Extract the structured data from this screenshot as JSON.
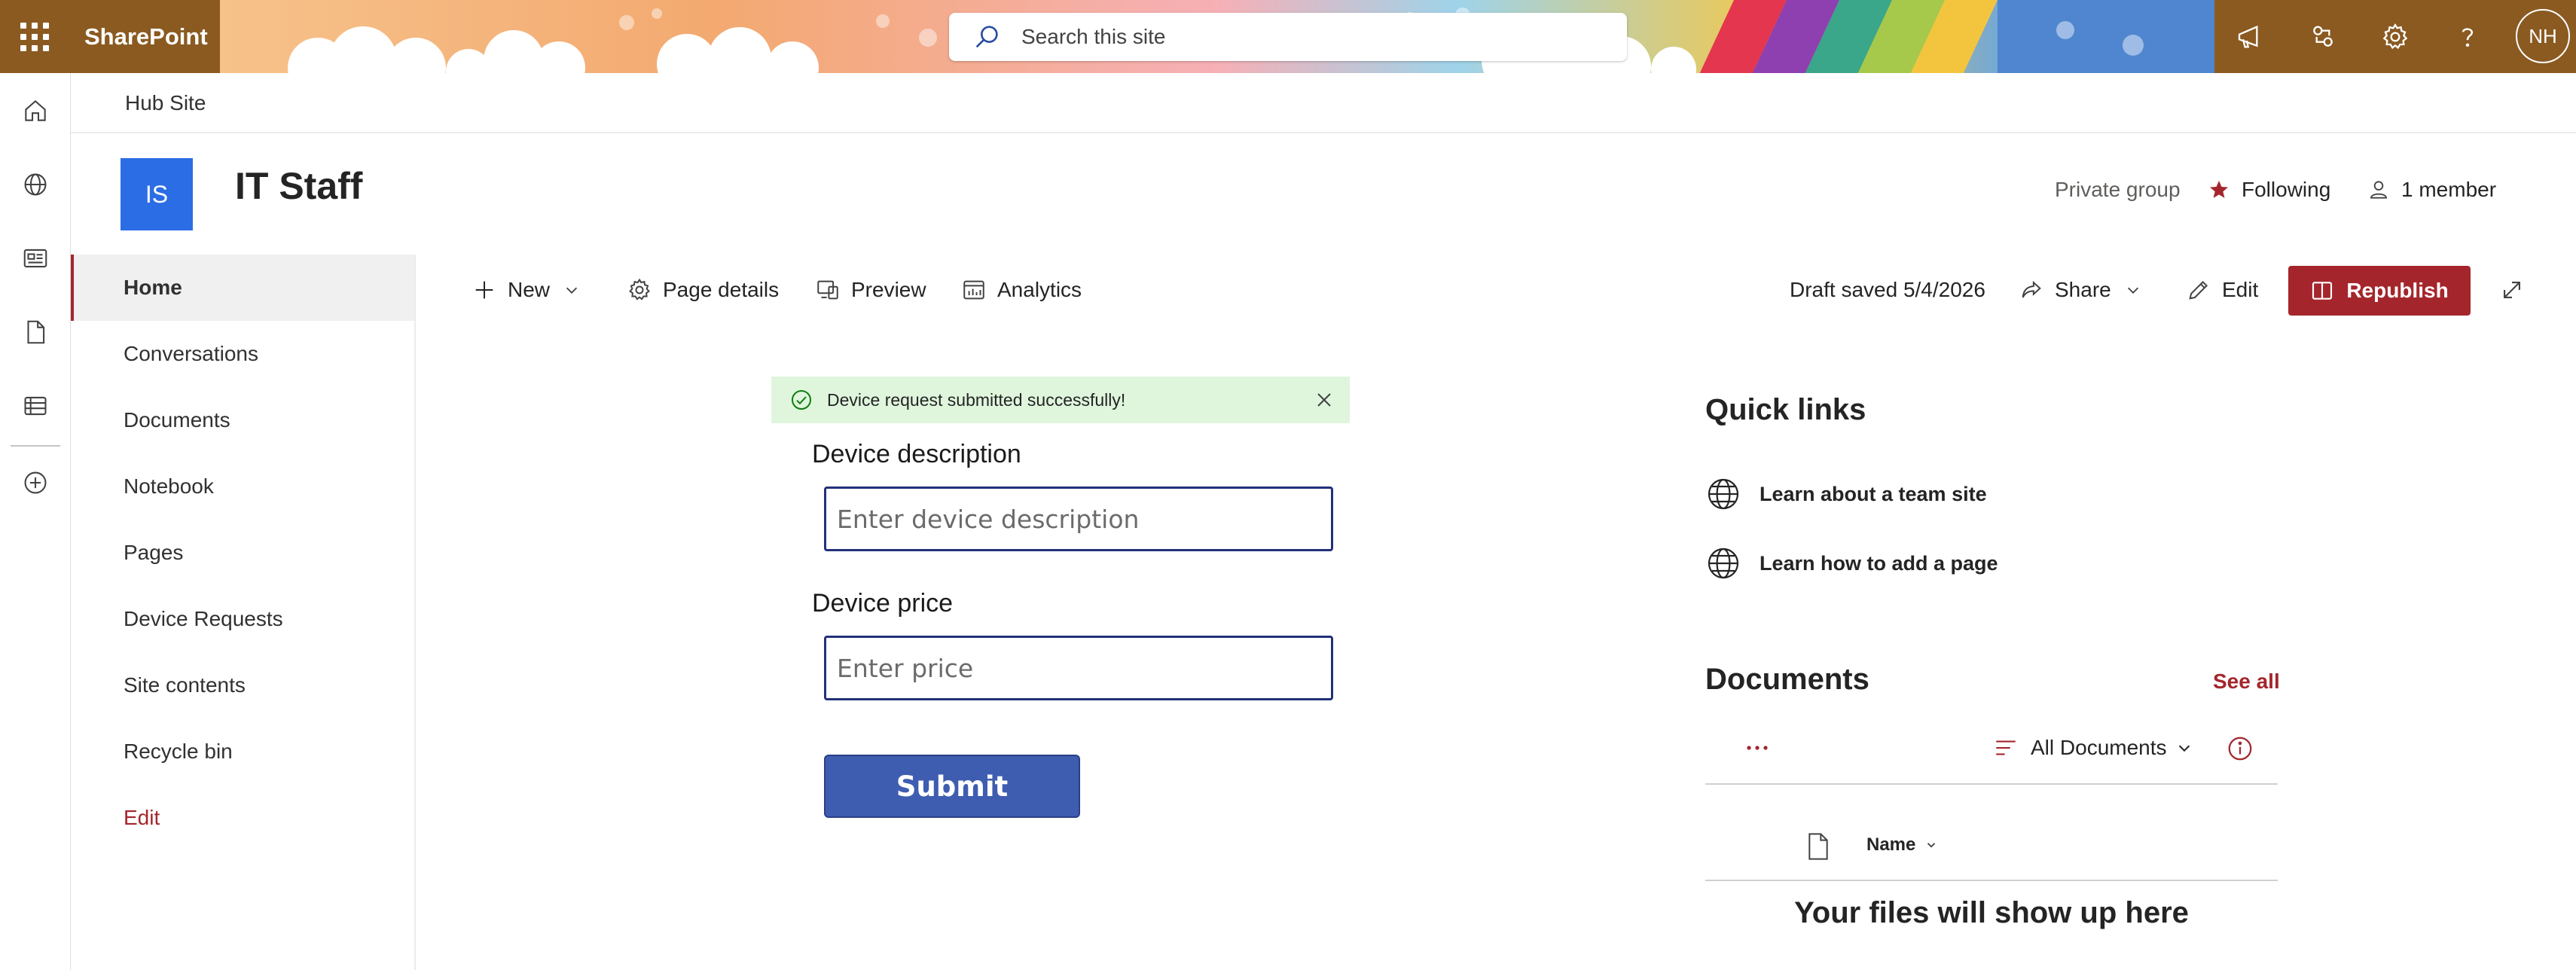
{
  "suite": {
    "app_name": "SharePoint",
    "search_placeholder": "Search this site",
    "user_initials": "NH",
    "icons": [
      "waffle-icon",
      "search-icon",
      "megaphone-icon",
      "share-sync-icon",
      "gear-icon",
      "help-icon"
    ],
    "colors": {
      "header_bg": "#8a5a21"
    }
  },
  "appbar": {
    "icons": [
      "home-icon",
      "globe-icon",
      "news-icon",
      "file-icon",
      "list-icon",
      "add-icon"
    ]
  },
  "hub": {
    "title": "Hub Site"
  },
  "site": {
    "logo_initials": "IS",
    "title": "IT Staff",
    "privacy": "Private group",
    "following_label": "Following",
    "members_label": "1 member",
    "colors": {
      "logo_bg": "#2b6de5",
      "accent": "#a4262c"
    }
  },
  "nav": {
    "items": [
      {
        "label": "Home",
        "active": true
      },
      {
        "label": "Conversations"
      },
      {
        "label": "Documents"
      },
      {
        "label": "Notebook"
      },
      {
        "label": "Pages"
      },
      {
        "label": "Device Requests"
      },
      {
        "label": "Site contents"
      },
      {
        "label": "Recycle bin"
      }
    ],
    "edit_label": "Edit"
  },
  "commandbar": {
    "new_label": "New",
    "page_details_label": "Page details",
    "preview_label": "Preview",
    "analytics_label": "Analytics",
    "draft_status": "Draft saved 5/4/2026",
    "share_label": "Share",
    "edit_label": "Edit",
    "republish_label": "Republish"
  },
  "form": {
    "success_message": "Device request submitted successfully!",
    "description_label": "Device description",
    "description_placeholder": "Enter device description",
    "description_value": "",
    "price_label": "Device price",
    "price_placeholder": "Enter price",
    "price_value": "",
    "submit_label": "Submit",
    "colors": {
      "success_bg": "#dff6dd",
      "button_bg": "#3f5db0",
      "input_border": "#23307a"
    }
  },
  "quick_links": {
    "title": "Quick links",
    "items": [
      {
        "label": "Learn about a team site"
      },
      {
        "label": "Learn how to add a page"
      }
    ]
  },
  "documents": {
    "title": "Documents",
    "see_all_label": "See all",
    "view_label": "All Documents",
    "column_name": "Name",
    "empty_message": "Your files will show up here"
  }
}
